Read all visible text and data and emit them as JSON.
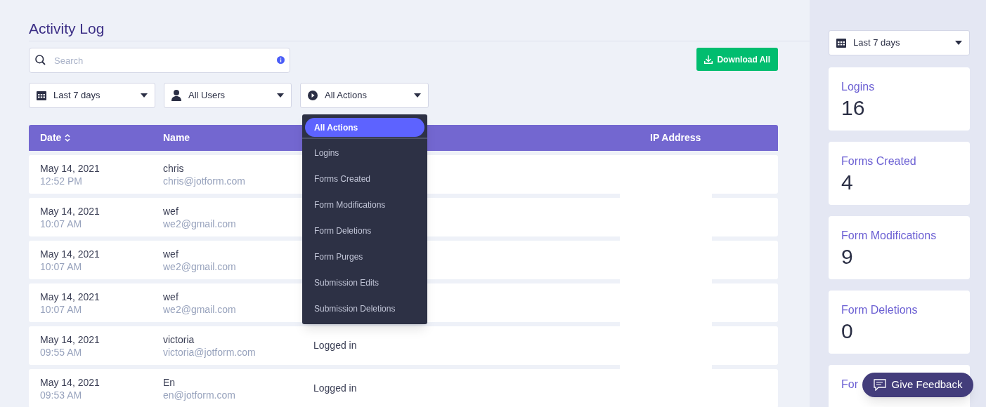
{
  "title": "Activity Log",
  "search": {
    "placeholder": "Search"
  },
  "download_button": "Download All",
  "filters": [
    {
      "kind": "calendar",
      "label": "Last 7 days"
    },
    {
      "kind": "user",
      "label": "All Users"
    },
    {
      "kind": "action",
      "label": "All Actions",
      "expanded": true
    }
  ],
  "action_menu": [
    {
      "label": "All Actions",
      "selected": true
    },
    {
      "label": "Logins",
      "selected": false
    },
    {
      "label": "Forms Created",
      "selected": false
    },
    {
      "label": "Form Modifications",
      "selected": false
    },
    {
      "label": "Form Deletions",
      "selected": false
    },
    {
      "label": "Form Purges",
      "selected": false
    },
    {
      "label": "Submission Edits",
      "selected": false
    },
    {
      "label": "Submission Deletions",
      "selected": false
    }
  ],
  "table": {
    "columns": [
      {
        "label": "Date",
        "sortable": true
      },
      {
        "label": "Name",
        "sortable": false
      },
      {
        "label": "IP Address",
        "sortable": false
      }
    ],
    "rows": [
      {
        "date": "May 14, 2021",
        "time": "12:52 PM",
        "name": "chris",
        "email": "chris@jotform.com"
      },
      {
        "date": "May 14, 2021",
        "time": "10:07 AM",
        "name": "wef",
        "email": "we2@gmail.com"
      },
      {
        "date": "May 14, 2021",
        "time": "10:07 AM",
        "name": "wef",
        "email": "we2@gmail.com"
      },
      {
        "date": "May 14, 2021",
        "time": "10:07 AM",
        "name": "wef",
        "email": "we2@gmail.com"
      },
      {
        "date": "May 14, 2021",
        "time": "09:55 AM",
        "name": "victoria",
        "email": "victoria@jotform.com",
        "action": "Logged in"
      },
      {
        "date": "May 14, 2021",
        "time": "09:53 AM",
        "name": "En",
        "email": "en@jotform.com",
        "action": "Logged in"
      }
    ]
  },
  "sidebar": {
    "period": "Last 7 days",
    "stats": [
      {
        "label": "Logins",
        "value": "16"
      },
      {
        "label": "Forms Created",
        "value": "4"
      },
      {
        "label": "Form Modifications",
        "value": "9"
      },
      {
        "label": "Form Deletions",
        "value": "0"
      },
      {
        "label": "For"
      }
    ]
  },
  "feedback_button": "Give Feedback"
}
